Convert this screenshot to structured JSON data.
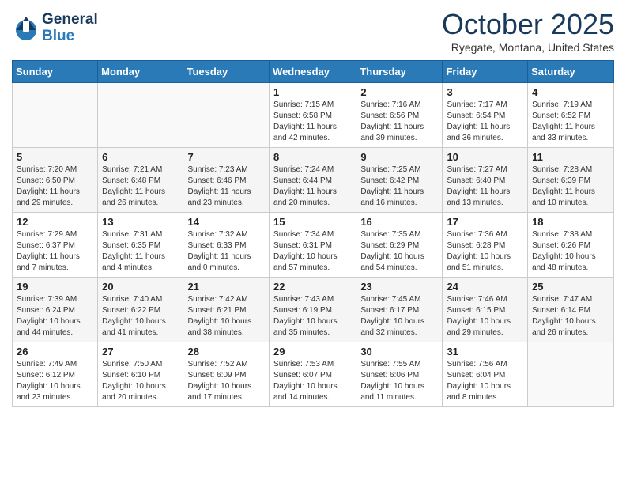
{
  "header": {
    "logo_general": "General",
    "logo_blue": "Blue",
    "month_title": "October 2025",
    "location": "Ryegate, Montana, United States"
  },
  "weekdays": [
    "Sunday",
    "Monday",
    "Tuesday",
    "Wednesday",
    "Thursday",
    "Friday",
    "Saturday"
  ],
  "weeks": [
    [
      {
        "day": "",
        "info": ""
      },
      {
        "day": "",
        "info": ""
      },
      {
        "day": "",
        "info": ""
      },
      {
        "day": "1",
        "info": "Sunrise: 7:15 AM\nSunset: 6:58 PM\nDaylight: 11 hours and 42 minutes."
      },
      {
        "day": "2",
        "info": "Sunrise: 7:16 AM\nSunset: 6:56 PM\nDaylight: 11 hours and 39 minutes."
      },
      {
        "day": "3",
        "info": "Sunrise: 7:17 AM\nSunset: 6:54 PM\nDaylight: 11 hours and 36 minutes."
      },
      {
        "day": "4",
        "info": "Sunrise: 7:19 AM\nSunset: 6:52 PM\nDaylight: 11 hours and 33 minutes."
      }
    ],
    [
      {
        "day": "5",
        "info": "Sunrise: 7:20 AM\nSunset: 6:50 PM\nDaylight: 11 hours and 29 minutes."
      },
      {
        "day": "6",
        "info": "Sunrise: 7:21 AM\nSunset: 6:48 PM\nDaylight: 11 hours and 26 minutes."
      },
      {
        "day": "7",
        "info": "Sunrise: 7:23 AM\nSunset: 6:46 PM\nDaylight: 11 hours and 23 minutes."
      },
      {
        "day": "8",
        "info": "Sunrise: 7:24 AM\nSunset: 6:44 PM\nDaylight: 11 hours and 20 minutes."
      },
      {
        "day": "9",
        "info": "Sunrise: 7:25 AM\nSunset: 6:42 PM\nDaylight: 11 hours and 16 minutes."
      },
      {
        "day": "10",
        "info": "Sunrise: 7:27 AM\nSunset: 6:40 PM\nDaylight: 11 hours and 13 minutes."
      },
      {
        "day": "11",
        "info": "Sunrise: 7:28 AM\nSunset: 6:39 PM\nDaylight: 11 hours and 10 minutes."
      }
    ],
    [
      {
        "day": "12",
        "info": "Sunrise: 7:29 AM\nSunset: 6:37 PM\nDaylight: 11 hours and 7 minutes."
      },
      {
        "day": "13",
        "info": "Sunrise: 7:31 AM\nSunset: 6:35 PM\nDaylight: 11 hours and 4 minutes."
      },
      {
        "day": "14",
        "info": "Sunrise: 7:32 AM\nSunset: 6:33 PM\nDaylight: 11 hours and 0 minutes."
      },
      {
        "day": "15",
        "info": "Sunrise: 7:34 AM\nSunset: 6:31 PM\nDaylight: 10 hours and 57 minutes."
      },
      {
        "day": "16",
        "info": "Sunrise: 7:35 AM\nSunset: 6:29 PM\nDaylight: 10 hours and 54 minutes."
      },
      {
        "day": "17",
        "info": "Sunrise: 7:36 AM\nSunset: 6:28 PM\nDaylight: 10 hours and 51 minutes."
      },
      {
        "day": "18",
        "info": "Sunrise: 7:38 AM\nSunset: 6:26 PM\nDaylight: 10 hours and 48 minutes."
      }
    ],
    [
      {
        "day": "19",
        "info": "Sunrise: 7:39 AM\nSunset: 6:24 PM\nDaylight: 10 hours and 44 minutes."
      },
      {
        "day": "20",
        "info": "Sunrise: 7:40 AM\nSunset: 6:22 PM\nDaylight: 10 hours and 41 minutes."
      },
      {
        "day": "21",
        "info": "Sunrise: 7:42 AM\nSunset: 6:21 PM\nDaylight: 10 hours and 38 minutes."
      },
      {
        "day": "22",
        "info": "Sunrise: 7:43 AM\nSunset: 6:19 PM\nDaylight: 10 hours and 35 minutes."
      },
      {
        "day": "23",
        "info": "Sunrise: 7:45 AM\nSunset: 6:17 PM\nDaylight: 10 hours and 32 minutes."
      },
      {
        "day": "24",
        "info": "Sunrise: 7:46 AM\nSunset: 6:15 PM\nDaylight: 10 hours and 29 minutes."
      },
      {
        "day": "25",
        "info": "Sunrise: 7:47 AM\nSunset: 6:14 PM\nDaylight: 10 hours and 26 minutes."
      }
    ],
    [
      {
        "day": "26",
        "info": "Sunrise: 7:49 AM\nSunset: 6:12 PM\nDaylight: 10 hours and 23 minutes."
      },
      {
        "day": "27",
        "info": "Sunrise: 7:50 AM\nSunset: 6:10 PM\nDaylight: 10 hours and 20 minutes."
      },
      {
        "day": "28",
        "info": "Sunrise: 7:52 AM\nSunset: 6:09 PM\nDaylight: 10 hours and 17 minutes."
      },
      {
        "day": "29",
        "info": "Sunrise: 7:53 AM\nSunset: 6:07 PM\nDaylight: 10 hours and 14 minutes."
      },
      {
        "day": "30",
        "info": "Sunrise: 7:55 AM\nSunset: 6:06 PM\nDaylight: 10 hours and 11 minutes."
      },
      {
        "day": "31",
        "info": "Sunrise: 7:56 AM\nSunset: 6:04 PM\nDaylight: 10 hours and 8 minutes."
      },
      {
        "day": "",
        "info": ""
      }
    ]
  ]
}
